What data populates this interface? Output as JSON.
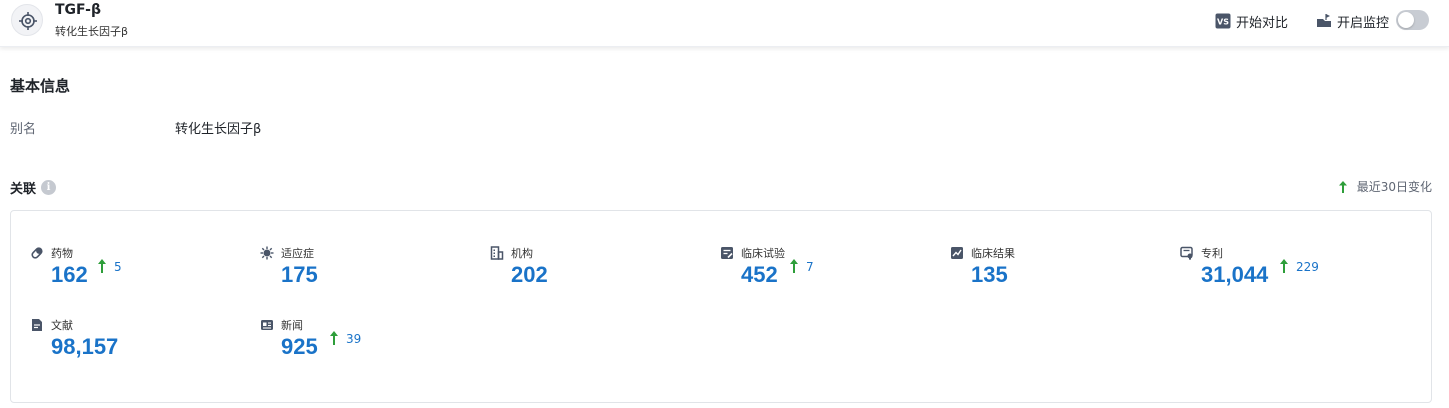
{
  "header": {
    "title": "TGF-β",
    "subtitle": "转化生长因子β",
    "compare_label": "开始对比",
    "monitor_label": "开启监控",
    "monitor_on": false
  },
  "basic": {
    "section_title": "基本信息",
    "alias_label": "别名",
    "alias_value": "转化生长因子β"
  },
  "relations": {
    "title": "关联",
    "recent_label": "最近30日变化",
    "colors": {
      "value": "#1a73c8",
      "up_arrow": "#2e9e3a"
    },
    "items": [
      {
        "label": "药物",
        "value": "162",
        "delta": "5",
        "icon": "pill-icon"
      },
      {
        "label": "适应症",
        "value": "175",
        "delta": "",
        "icon": "virus-icon"
      },
      {
        "label": "机构",
        "value": "202",
        "delta": "",
        "icon": "building-icon"
      },
      {
        "label": "临床试验",
        "value": "452",
        "delta": "7",
        "icon": "clinical-trial-icon"
      },
      {
        "label": "临床结果",
        "value": "135",
        "delta": "",
        "icon": "clinical-result-icon"
      },
      {
        "label": "专利",
        "value": "31,044",
        "delta": "229",
        "icon": "patent-icon"
      },
      {
        "label": "文献",
        "value": "98,157",
        "delta": "",
        "icon": "document-icon"
      },
      {
        "label": "新闻",
        "value": "925",
        "delta": "39",
        "icon": "news-icon"
      }
    ]
  }
}
